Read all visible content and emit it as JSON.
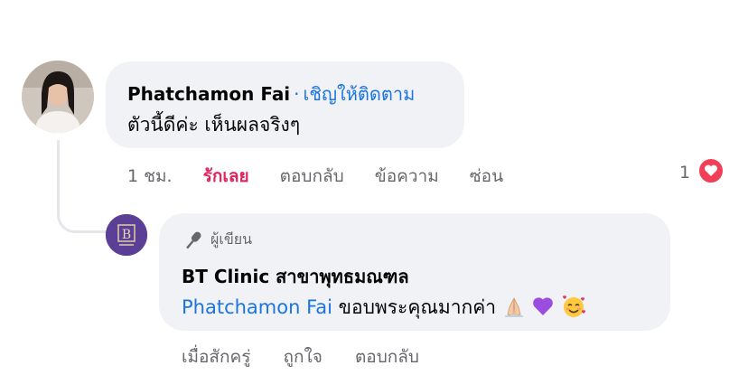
{
  "comment1": {
    "author": "Phatchamon Fai",
    "separator": "·",
    "follow_label": "เชิญให้ติดตาม",
    "text": "ตัวนี้ดีค่ะ เห็นผลจริงๆ",
    "time": "1 ชม.",
    "love_label": "รักเลย",
    "reply_label": "ตอบกลับ",
    "message_label": "ข้อความ",
    "hide_label": "ซ่อน",
    "reaction_count": "1",
    "reaction_icon": "heart-icon"
  },
  "comment2": {
    "author_badge": "ผู้เขียน",
    "author": "BT Clinic สาขาพุทธมณฑล",
    "mention": "Phatchamon Fai",
    "text": " ขอบพระคุณมากค่า",
    "emojis": [
      "folded-hands",
      "purple-heart",
      "smiling-face-with-hearts"
    ],
    "time": "เมื่อสักครู่",
    "like_label": "ถูกใจ",
    "reply_label": "ตอบกลับ"
  },
  "colors": {
    "bubble": "#f0f2f5",
    "link": "#1b74e4",
    "love": "#e0245e",
    "muted": "#65676b",
    "heart_badge": "#f33e58"
  }
}
